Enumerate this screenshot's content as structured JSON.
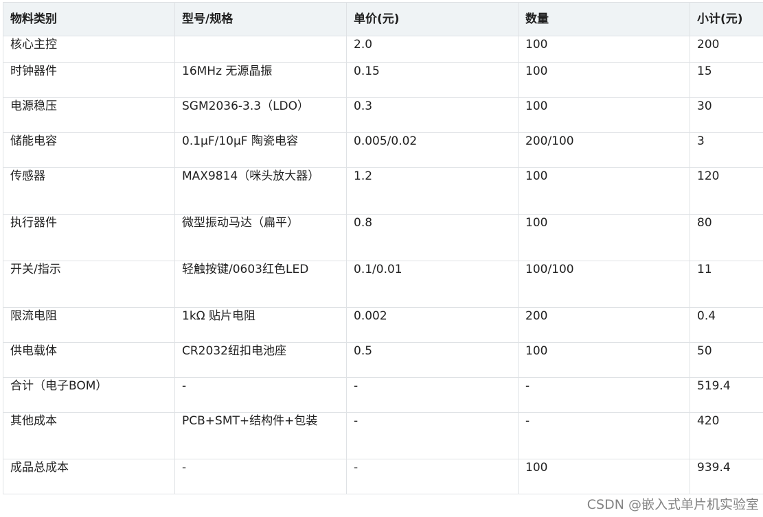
{
  "table": {
    "headers": [
      "物料类别",
      "型号/规格",
      "单价(元)",
      "数量",
      "小计(元)"
    ],
    "rows": [
      [
        "核心主控",
        "",
        "2.0",
        "100",
        "200"
      ],
      [
        "时钟器件",
        "16MHz 无源晶振",
        "0.15",
        "100",
        "15"
      ],
      [
        "电源稳压",
        "SGM2036-3.3（LDO）",
        "0.3",
        "100",
        "30"
      ],
      [
        "储能电容",
        "0.1μF/10μF 陶瓷电容",
        "0.005/0.02",
        "200/100",
        "3"
      ],
      [
        "传感器",
        "MAX9814（咪头放大器）",
        "1.2",
        "100",
        "120"
      ],
      [
        "执行器件",
        "微型振动马达（扁平）",
        "0.8",
        "100",
        "80"
      ],
      [
        "开关/指示",
        "轻触按键/0603红色LED",
        "0.1/0.01",
        "100/100",
        "11"
      ],
      [
        "限流电阻",
        "1kΩ 贴片电阻",
        "0.002",
        "200",
        "0.4"
      ],
      [
        "供电载体",
        "CR2032纽扣电池座",
        "0.5",
        "100",
        "50"
      ],
      [
        "合计（电子BOM）",
        "-",
        "-",
        "-",
        "519.4"
      ],
      [
        "其他成本",
        "PCB+SMT+结构件+包装",
        "-",
        "-",
        "420"
      ],
      [
        "成品总成本",
        "-",
        "-",
        "100",
        "939.4"
      ]
    ]
  },
  "watermark": "CSDN @嵌入式单片机实验室",
  "colors": {
    "header_bg": "#eff3f5",
    "border": "#dfe2e5",
    "text": "#222222"
  }
}
